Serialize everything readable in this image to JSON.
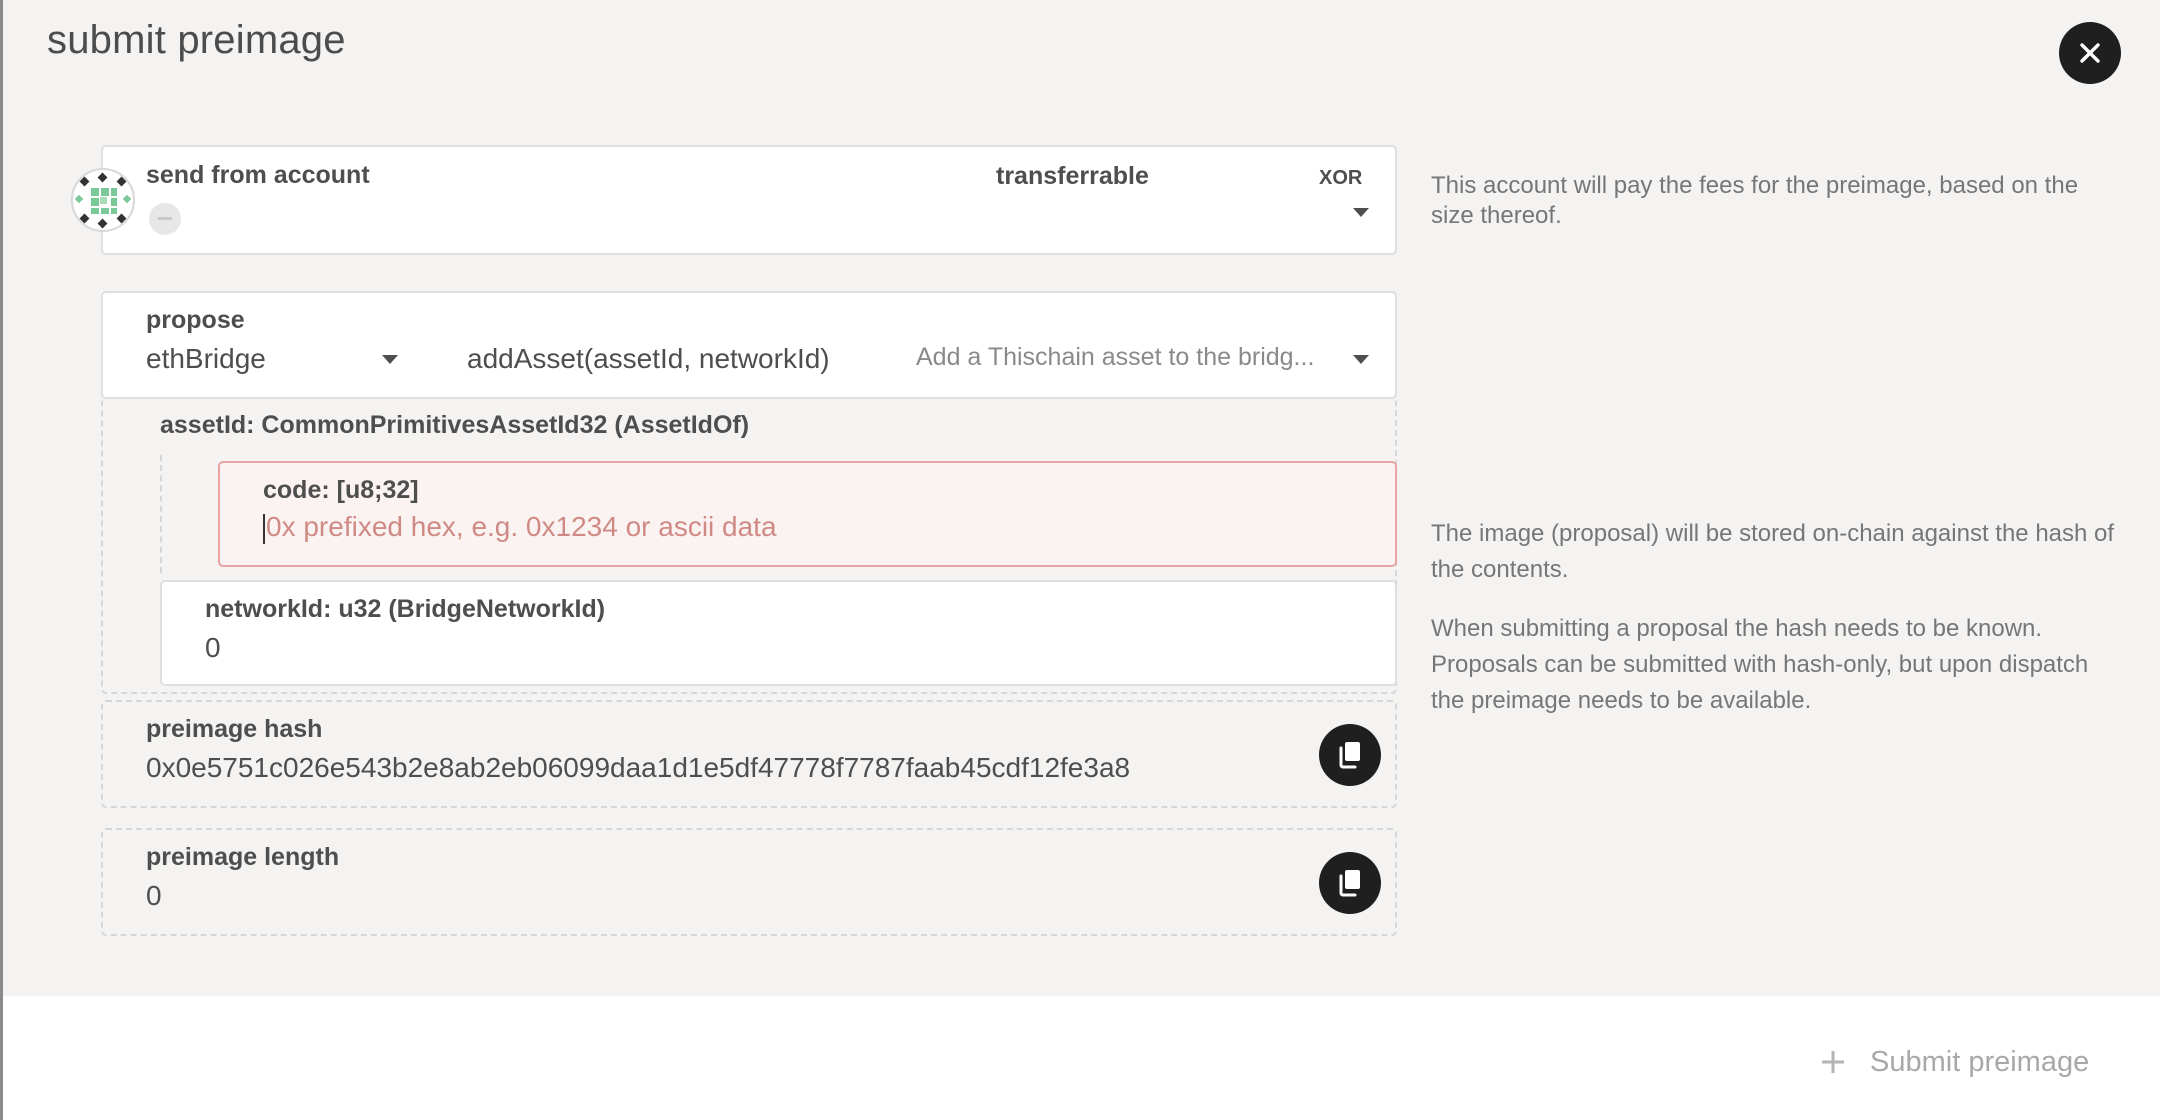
{
  "modal": {
    "title": "submit preimage"
  },
  "account": {
    "label": "send from account",
    "transferrable_label": "transferrable",
    "token": "XOR",
    "help": "This account will pay the fees for the preimage, based on the size thereof."
  },
  "propose": {
    "label": "propose",
    "section": "ethBridge",
    "method": "addAsset(assetId, networkId)",
    "description": "Add a Thischain asset to the bridg..."
  },
  "params": {
    "asset_id_label": "assetId: CommonPrimitivesAssetId32 (AssetIdOf)",
    "code_label": "code: [u8;32]",
    "code_placeholder": "0x prefixed hex, e.g. 0x1234 or ascii data",
    "network_id_label": "networkId: u32 (BridgeNetworkId)",
    "network_id_value": "0",
    "help_1": "The image (proposal) will be stored on-chain against the hash of the contents.",
    "help_2": "When submitting a proposal the hash needs to be known. Proposals can be submitted with hash-only, but upon dispatch the preimage needs to be available."
  },
  "hash": {
    "label": "preimage hash",
    "value": "0x0e5751c026e543b2e8ab2eb06099daa1d1e5df47778f7787faab45cdf12fe3a8"
  },
  "length": {
    "label": "preimage length",
    "value": "0"
  },
  "footer": {
    "submit_label": "Submit preimage",
    "submit_icon": "plus-icon"
  },
  "colors": {
    "modal_bg": "#f4f3f2",
    "error_border": "#e8a3a3",
    "error_bg": "#fbf3f2",
    "placeholder": "#d08a85"
  }
}
